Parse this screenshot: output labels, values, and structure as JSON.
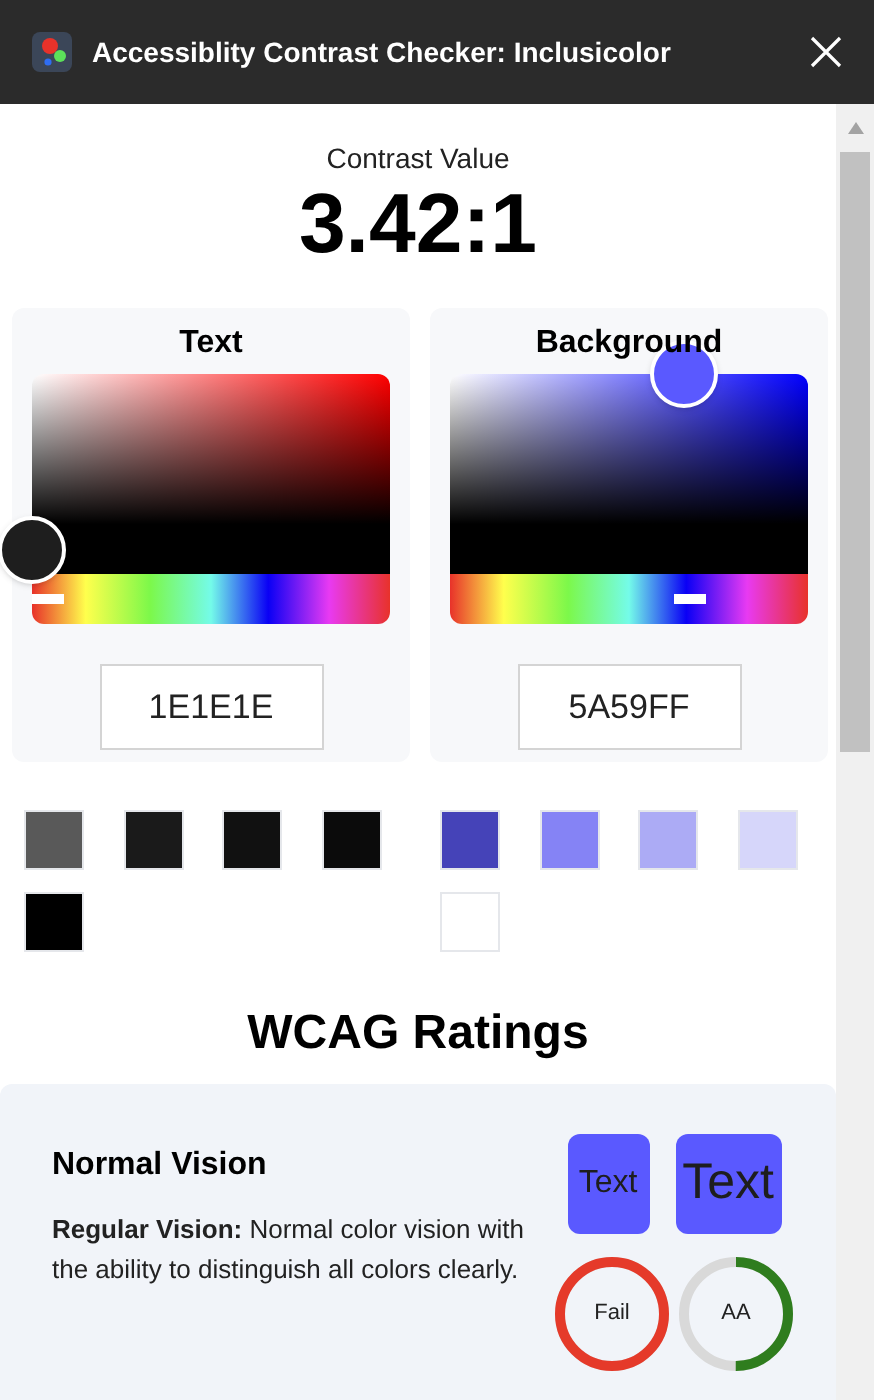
{
  "window": {
    "title": "Accessiblity Contrast Checker: Inclusicolor"
  },
  "contrast": {
    "label": "Contrast Value",
    "value": "3.42:1"
  },
  "pickers": [
    {
      "title": "Text",
      "value": "1E1E1E",
      "swatches": [
        {
          "color": "#595959"
        },
        {
          "color": "#1a1a1a"
        },
        {
          "color": "#111111"
        },
        {
          "color": "#0b0b0b"
        },
        {
          "color": "#000000"
        }
      ]
    },
    {
      "title": "Background",
      "value": "5A59FF",
      "swatches": [
        {
          "color": "#4543b8"
        },
        {
          "color": "#8583f5"
        },
        {
          "color": "#acabf5"
        },
        {
          "color": "#d6d6fa"
        },
        {
          "color": "#ffffff"
        }
      ]
    }
  ],
  "wcag": {
    "title": "WCAG Ratings",
    "card": {
      "title": "Normal Vision",
      "description": "**Regular Vision:** Normal color vision with the ability to distinguish all colors clearly.",
      "previews": [
        {
          "label": "Text",
          "kind": "small"
        },
        {
          "label": "Text",
          "kind": "large"
        }
      ],
      "ratings": [
        {
          "label": "Fail",
          "level": 1,
          "color": "#e53a2a"
        },
        {
          "label": "AA",
          "level": 0.5,
          "color": "#2f7d1e"
        }
      ]
    }
  }
}
